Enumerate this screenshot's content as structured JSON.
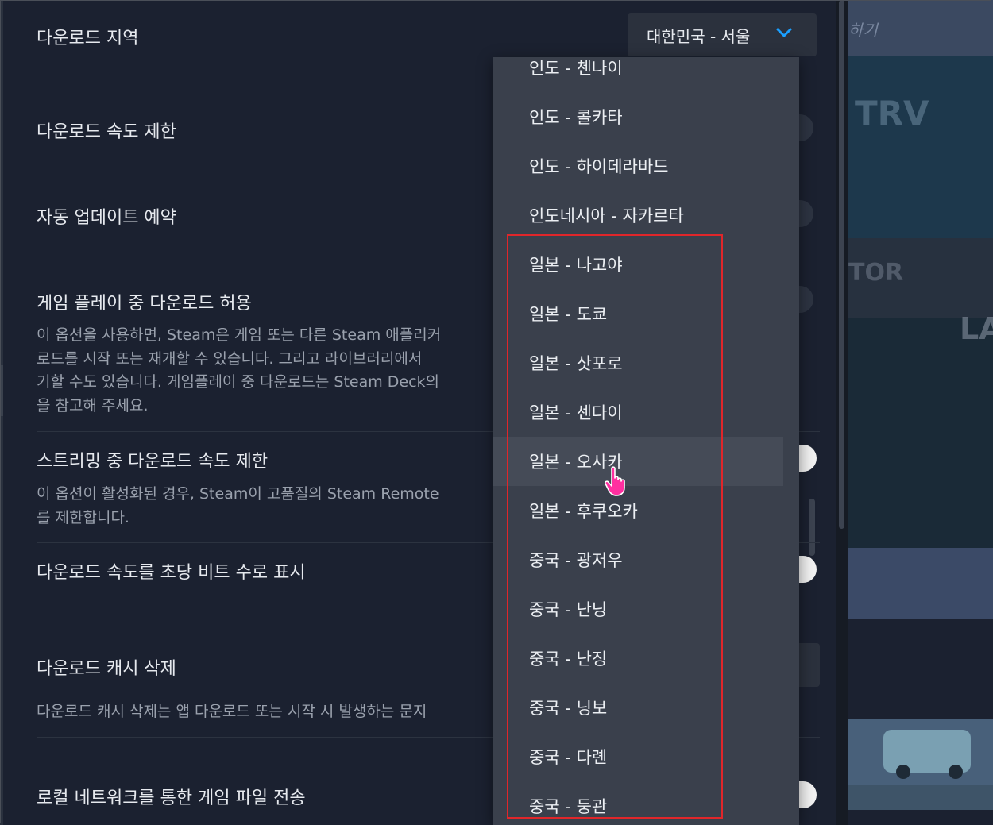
{
  "settings": {
    "download_region": {
      "label": "다운로드 지역",
      "selected": "대한민국 - 서울"
    },
    "speed_limit": {
      "label": "다운로드 속도 제한"
    },
    "auto_update": {
      "label": "자동 업데이트 예약"
    },
    "gameplay_download": {
      "label": "게임 플레이 중 다운로드 허용",
      "desc": [
        "이 옵션을 사용하면, Steam은 게임 또는 다른 Steam 애플리커",
        "로드를 시작 또는 재개할 수 있습니다. 그리고 라이브러리에서",
        "기할 수도 있습니다. 게임플레이 중 다운로드는 Steam Deck의",
        "을 참고해 주세요."
      ]
    },
    "streaming_limit": {
      "label": "스트리밍 중 다운로드 속도 제한",
      "desc": [
        "이 옵션이 활성화된 경우, Steam이 고품질의 Steam Remote",
        "를 제한합니다."
      ]
    },
    "bits_display": {
      "label": "다운로드 속도를 초당 비트 수로 표시"
    },
    "clear_cache": {
      "label": "다운로드 캐시 삭제",
      "desc": "다운로드 캐시 삭제는 앱 다운로드 또는 시작 시 발생하는 문지"
    },
    "lan_transfer": {
      "label": "로컬 네트워크를 통한 게임 파일 전송"
    }
  },
  "dropdown": {
    "items": [
      "인도 - 첸나이",
      "인도 - 콜카타",
      "인도 - 하이데라바드",
      "인도네시아 - 자카르타",
      "일본 - 나고야",
      "일본 - 도쿄",
      "일본 - 삿포로",
      "일본 - 센다이",
      "일본 - 오사카",
      "일본 - 후쿠오카",
      "중국 - 광저우",
      "중국 - 난닝",
      "중국 - 난징",
      "중국 - 닝보",
      "중국 - 다롄",
      "중국 - 둥관"
    ],
    "hovered": "일본 - 오사카"
  },
  "background": {
    "top_text": "하기",
    "tile_text_1": "TRV",
    "tile_text_2": "TOR",
    "tile_text_3": "LA"
  },
  "icons": {
    "dropdown_chevron": "chevron-down-icon",
    "cursor": "hand-pointer-icon"
  },
  "colors": {
    "accent": "#1a9fff",
    "highlight_box": "#e0262a",
    "cursor": "#ff2fa0"
  }
}
